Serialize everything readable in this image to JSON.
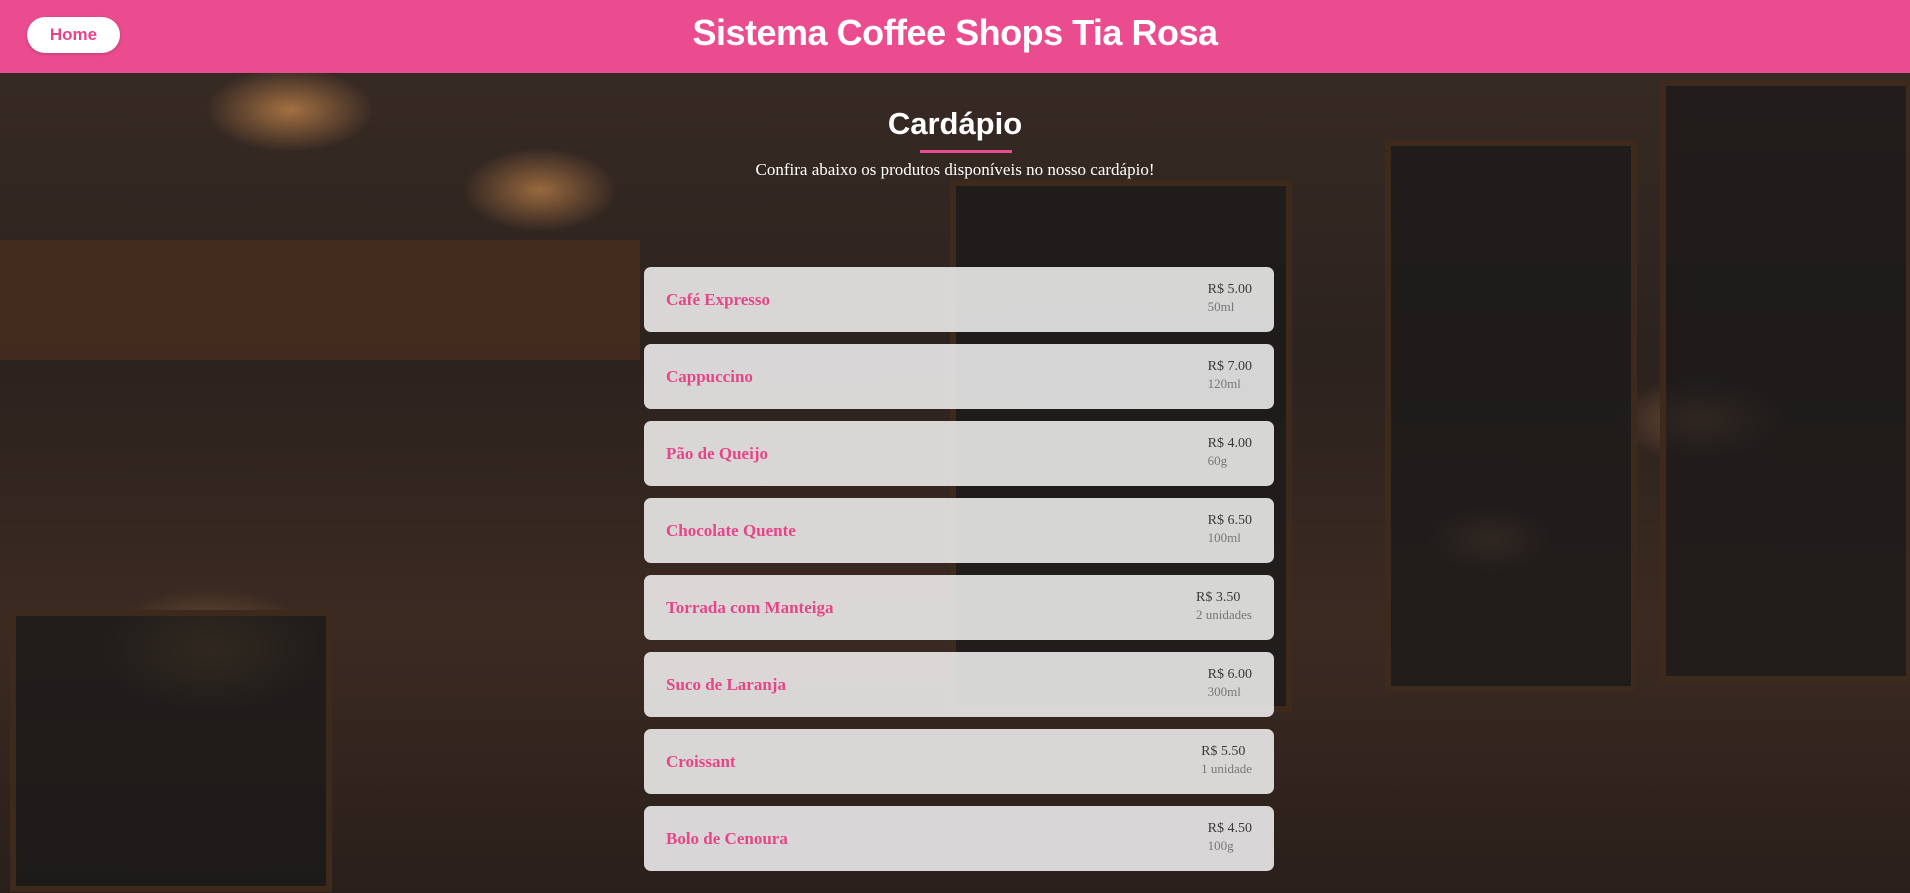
{
  "header": {
    "home_label": "Home",
    "site_title": "Sistema Coffee Shops Tia Rosa"
  },
  "colors": {
    "brand_pink": "#ea4c8f",
    "card_background": "#f5f5f5"
  },
  "section": {
    "title": "Cardápio",
    "subtitle": "Confira abaixo os produtos disponíveis no nosso cardápio!"
  },
  "menu": {
    "items": [
      {
        "name": "Café Expresso",
        "price": "R$ 5.00",
        "size": "50ml"
      },
      {
        "name": "Cappuccino",
        "price": "R$ 7.00",
        "size": "120ml"
      },
      {
        "name": "Pão de Queijo",
        "price": "R$ 4.00",
        "size": "60g"
      },
      {
        "name": "Chocolate Quente",
        "price": "R$ 6.50",
        "size": "100ml"
      },
      {
        "name": "Torrada com Manteiga",
        "price": "R$ 3.50",
        "size": "2 unidades"
      },
      {
        "name": "Suco de Laranja",
        "price": "R$ 6.00",
        "size": "300ml"
      },
      {
        "name": "Croissant",
        "price": "R$ 5.50",
        "size": "1 unidade"
      },
      {
        "name": "Bolo de Cenoura",
        "price": "R$ 4.50",
        "size": "100g"
      }
    ]
  }
}
